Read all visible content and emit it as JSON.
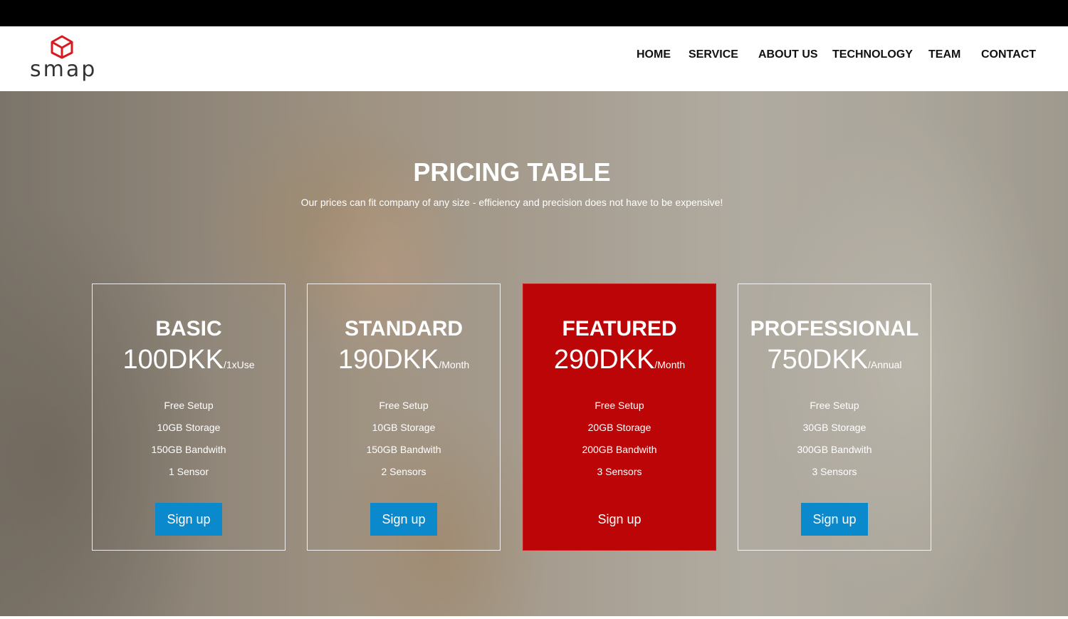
{
  "brand": {
    "name": "smap",
    "icon": "cube-icon",
    "accent": "#d71920"
  },
  "nav": {
    "items": [
      {
        "label": "HOME"
      },
      {
        "label": "SERVICE"
      },
      {
        "label": "ABOUT US"
      },
      {
        "label": "TECHNOLOGY"
      },
      {
        "label": "TEAM"
      },
      {
        "label": "CONTACT"
      }
    ]
  },
  "hero": {
    "title": "PRICING TABLE",
    "subtitle": "Our prices can fit company of any size - efficiency and precision does not have to be expensive!"
  },
  "plans": [
    {
      "name": "BASIC",
      "price": "100DKK",
      "period": "/1xUse",
      "features": [
        "Free Setup",
        "10GB Storage",
        "150GB Bandwith",
        "1 Sensor"
      ],
      "cta": "Sign up"
    },
    {
      "name": "STANDARD",
      "price": "190DKK",
      "period": "/Month",
      "features": [
        "Free Setup",
        "10GB Storage",
        "150GB Bandwith",
        "2 Sensors"
      ],
      "cta": "Sign up"
    },
    {
      "name": "FEATURED",
      "price": "290DKK",
      "period": "/Month",
      "features": [
        "Free Setup",
        "20GB Storage",
        "200GB Bandwith",
        "3 Sensors"
      ],
      "cta": "Sign up",
      "highlight": true
    },
    {
      "name": "PROFESSIONAL",
      "price": "750DKK",
      "period": "/Annual",
      "features": [
        "Free Setup",
        "30GB Storage",
        "300GB Bandwith",
        "3 Sensors"
      ],
      "cta": "Sign up"
    }
  ],
  "colors": {
    "featured": "#bb0506",
    "button": "#0a89cc",
    "topbar": "#000000"
  }
}
